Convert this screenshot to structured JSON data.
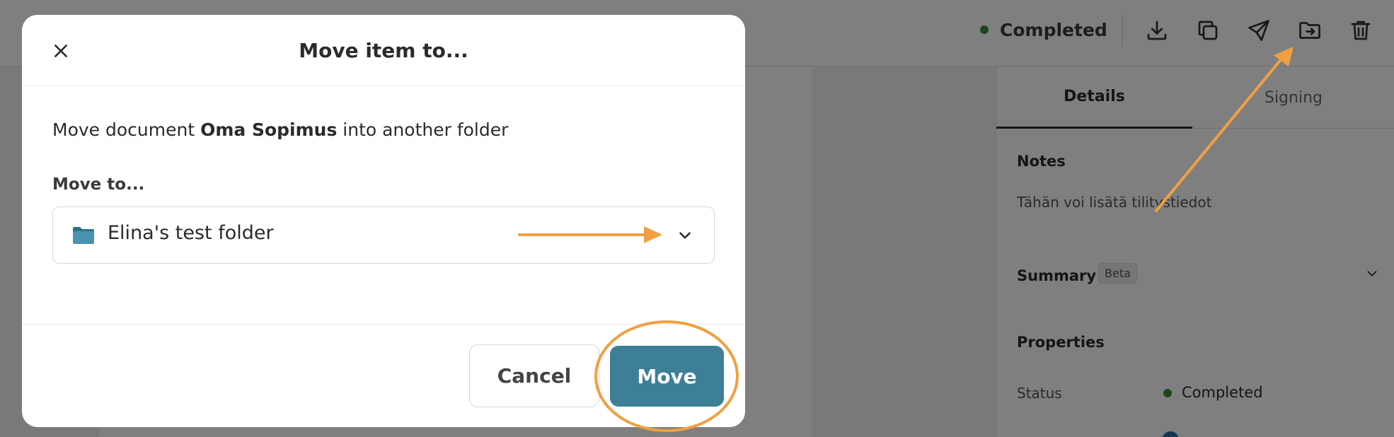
{
  "toolbar": {
    "status": "Completed",
    "status_color": "#3a8a3a",
    "icons": [
      "download-icon",
      "copy-icon",
      "send-icon",
      "move-to-folder-icon",
      "trash-icon"
    ]
  },
  "document": {
    "partial_text": ")"
  },
  "side_panel": {
    "tabs": [
      "Details",
      "Signing"
    ],
    "notes_heading": "Notes",
    "notes_text": "Tähän voi lisätä tilitystiedot",
    "summary_heading": "Summary",
    "summary_badge": "Beta",
    "properties_heading": "Properties",
    "status_label": "Status",
    "status_value": "Completed"
  },
  "modal": {
    "title": "Move item to...",
    "desc_prefix": "Move document ",
    "document_name": "Oma Sopimus",
    "desc_suffix": " into another folder",
    "move_to_label": "Move to...",
    "selected_folder": "Elina's test folder",
    "cancel_label": "Cancel",
    "move_label": "Move",
    "accent_color": "#3d7f96"
  },
  "annotations": {
    "color": "#f0a040"
  }
}
